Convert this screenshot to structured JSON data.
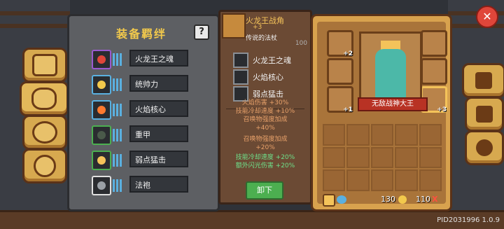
{
  "header": {
    "close_glyph": "✕"
  },
  "bond_panel": {
    "title": "装备羁绊",
    "help_label": "?",
    "bonds": [
      {
        "label": "火龙王之魂",
        "gem_color": "#e0463a",
        "slot_border": "#9a5ad0"
      },
      {
        "label": "统帅力",
        "gem_color": "#f2c94c",
        "slot_border": "#5ab0e0"
      },
      {
        "label": "火焰核心",
        "gem_color": "#ff7a2f",
        "slot_border": "#5ab0e0"
      },
      {
        "label": "重甲",
        "gem_color": "#4a5a4a",
        "slot_border": "#4caf50"
      },
      {
        "label": "弱点猛击",
        "gem_color": "#f4c35a",
        "slot_border": "#4caf50"
      },
      {
        "label": "法袍",
        "gem_color": "#9aa0a6",
        "slot_border": "#e0e0e0"
      }
    ]
  },
  "item_panel": {
    "name": "火龙王战角",
    "level": "+3",
    "subtitle": "传说的法杖",
    "sub_row": "100",
    "components": [
      {
        "name": "火龙王之魂"
      },
      {
        "name": "火焰核心"
      },
      {
        "name": "弱点猛击"
      }
    ],
    "stats": [
      {
        "text": "火焰伤害 +30%",
        "color": "orange"
      },
      {
        "text": "技能冷却速度 +10%",
        "color": "orange"
      },
      {
        "text": "召唤物强度加成",
        "color": "orange"
      },
      {
        "text": "+40%",
        "color": "orange"
      },
      {
        "text": "召唤物强度加成",
        "color": "orange"
      },
      {
        "text": "+20%",
        "color": "orange"
      },
      {
        "text": "技能冷却速度 +20%",
        "color": "green"
      },
      {
        "text": "额外闪光伤害 +20%",
        "color": "green"
      }
    ],
    "unequip_label": "卸下"
  },
  "equip_panel": {
    "hero_name": "无敌战神大王",
    "slots": [
      {
        "pos": "tl",
        "badge": "+2"
      },
      {
        "pos": "ml",
        "badge": ""
      },
      {
        "pos": "bl",
        "badge": "+1"
      },
      {
        "pos": "tr",
        "badge": ""
      },
      {
        "pos": "mr",
        "badge": ""
      },
      {
        "pos": "br",
        "badge": "+3"
      }
    ],
    "gems": "130",
    "coins": "110",
    "coins_suffix": "X"
  },
  "build_info": "PID2031996 1.0.9",
  "colors": {
    "accent": "#f2c94c",
    "gold_panel": "#d8a24e",
    "item_panel": "#6b4a34"
  }
}
